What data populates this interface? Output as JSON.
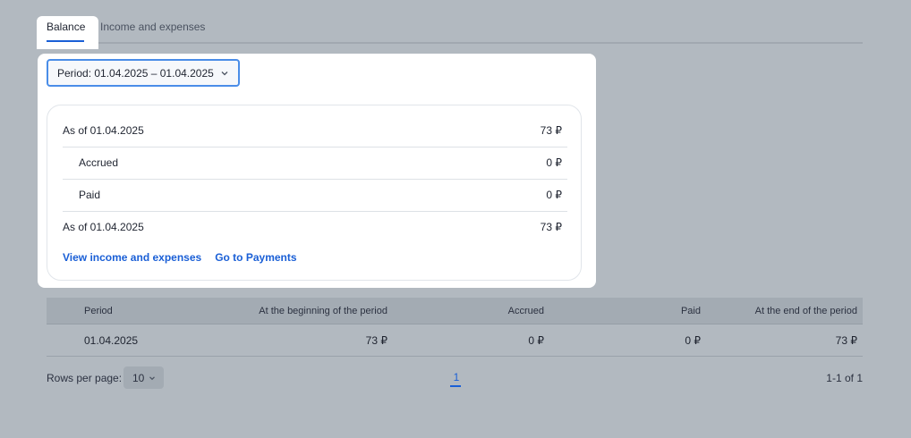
{
  "tabs": [
    {
      "label": "Balance",
      "active": true
    },
    {
      "label": "Income and expenses",
      "active": false
    }
  ],
  "period": {
    "label": "Period: 01.04.2025 – 01.04.2025"
  },
  "summary": {
    "rows": [
      {
        "label": "As of 01.04.2025",
        "value": "73 ₽"
      },
      {
        "label": "Accrued",
        "value": "0 ₽"
      },
      {
        "label": "Paid",
        "value": "0 ₽"
      },
      {
        "label": "As of 01.04.2025",
        "value": "73 ₽"
      }
    ],
    "links": {
      "income": "View income and expenses",
      "payments": "Go to Payments"
    }
  },
  "table": {
    "headers": [
      "Period",
      "At the beginning of the period",
      "Accrued",
      "Paid",
      "At the end of the period"
    ],
    "rows": [
      [
        "01.04.2025",
        "73 ₽",
        "0 ₽",
        "0 ₽",
        "73 ₽"
      ]
    ]
  },
  "pager": {
    "rows_label": "Rows per page:",
    "rows_value": "10",
    "page": "1",
    "range": "1-1 of 1"
  },
  "colors": {
    "accent": "#1a5fd6",
    "backdrop": "#b2b9c0"
  }
}
